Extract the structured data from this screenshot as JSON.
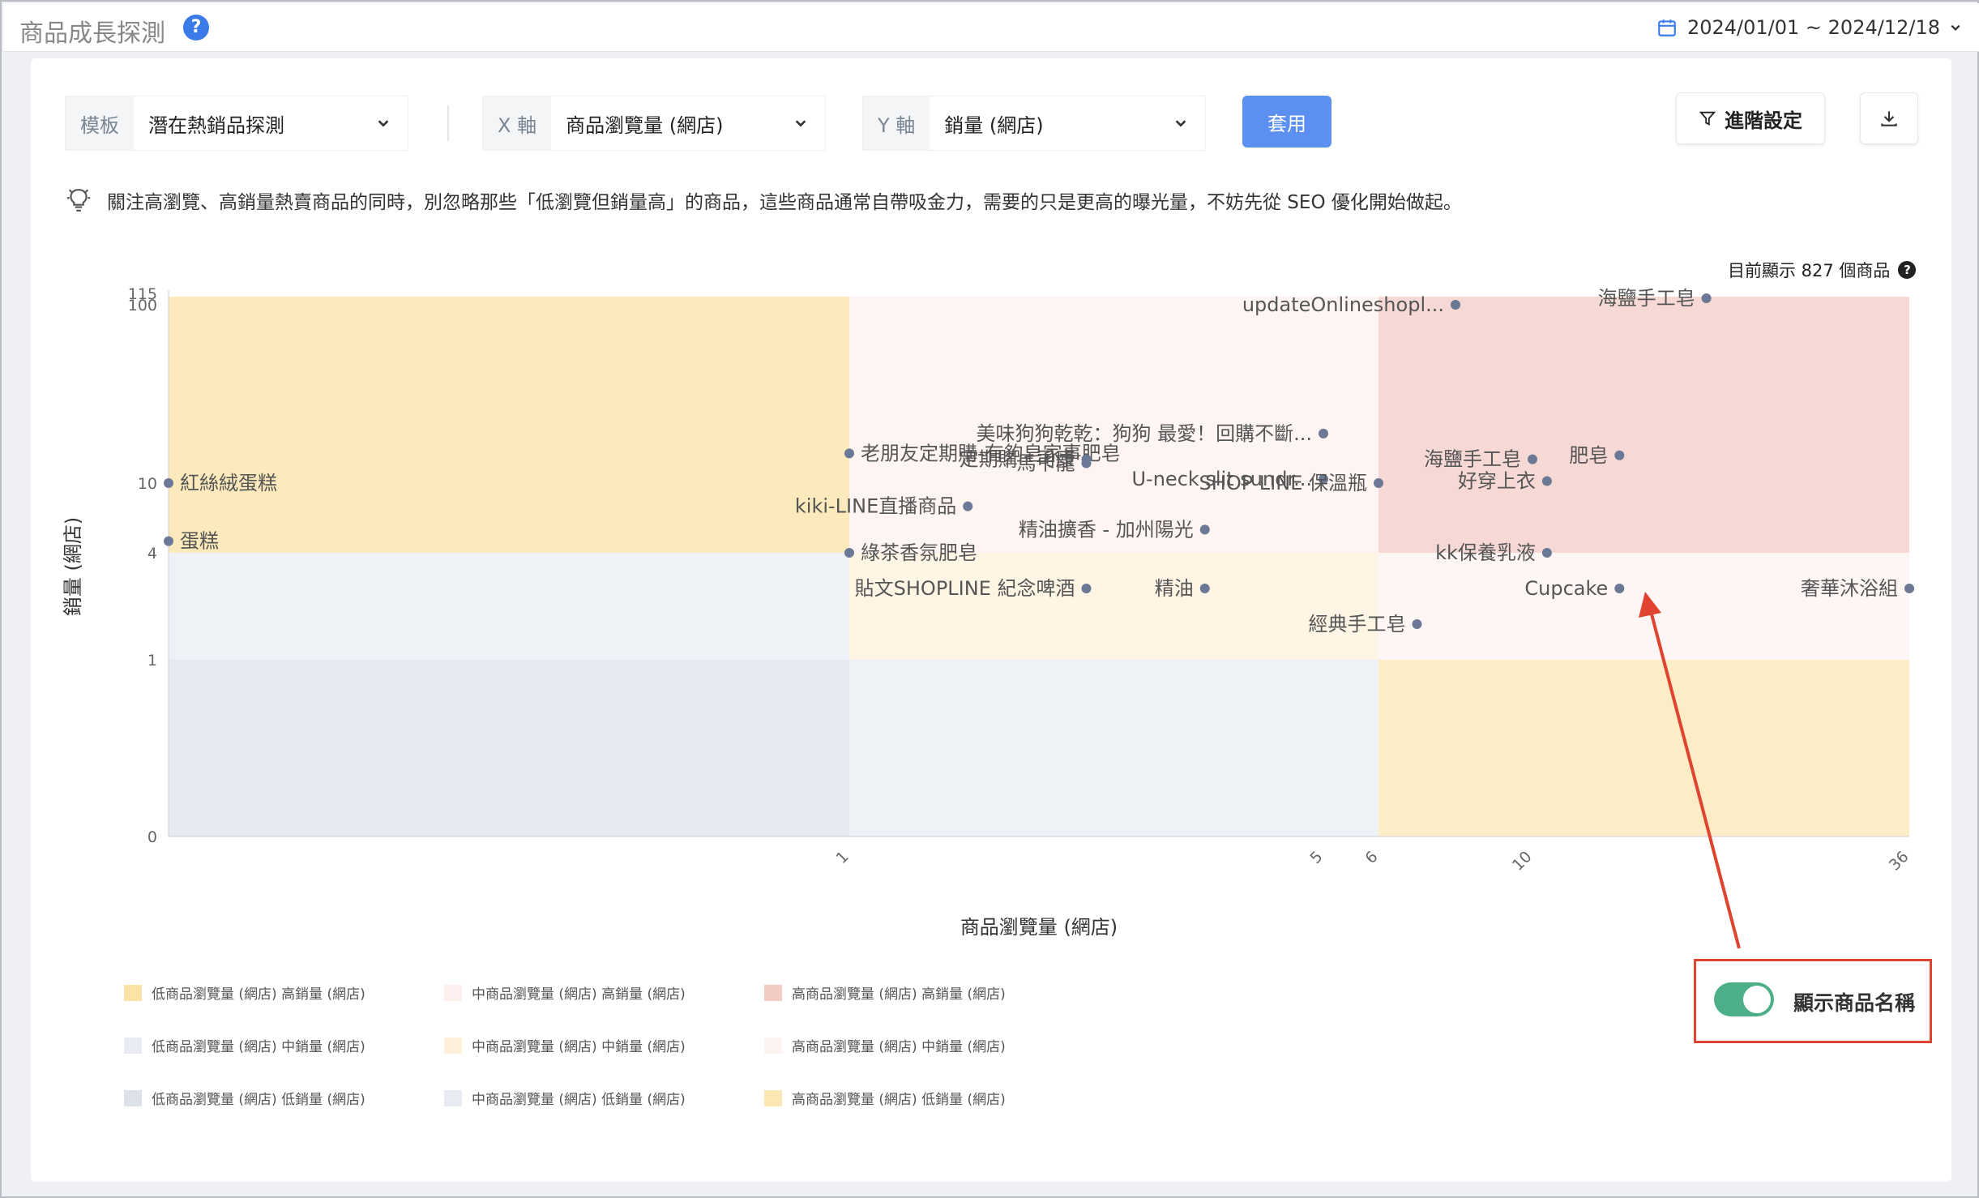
{
  "header": {
    "title": "商品成長探測",
    "date_range": "2024/01/01 ~ 2024/12/18"
  },
  "controls": {
    "template_label": "模板",
    "template_value": "潛在熱銷品探測",
    "x_label": "X 軸",
    "x_value": "商品瀏覽量 (網店)",
    "y_label": "Y 軸",
    "y_value": "銷量 (網店)",
    "apply": "套用",
    "advanced": "進階設定"
  },
  "tip": "關注高瀏覽、高銷量熱賣商品的同時，別忽略那些「低瀏覽但銷量高」的商品，這些商品通常自帶吸金力，需要的只是更高的曝光量，不妨先從 SEO 優化開始做起。",
  "count_text": "目前顯示 827 個商品",
  "toggle_label": "顯示商品名稱",
  "colors": {
    "accent": "#5b8ff2",
    "toggle": "#4caf87",
    "highlight": "#e0432f"
  },
  "chart_data": {
    "type": "scatter",
    "xlabel": "商品瀏覽量 (網店)",
    "ylabel": "銷量 (網店)",
    "x_ticks": [
      "1",
      "5",
      "6",
      "10",
      "36"
    ],
    "y_ticks": [
      "115",
      "100",
      "10",
      "4",
      "1",
      "0"
    ],
    "legend": [
      {
        "name": "低商品瀏覽量 (網店) 高銷量 (網店)",
        "color": "#fbe3a6"
      },
      {
        "name": "中商品瀏覽量 (網店) 高銷量 (網店)",
        "color": "#fdf0ee"
      },
      {
        "name": "高商品瀏覽量 (網店) 高銷量 (網店)",
        "color": "#f3cbc5"
      },
      {
        "name": "低商品瀏覽量 (網店) 中銷量 (網店)",
        "color": "#e8ecf2"
      },
      {
        "name": "中商品瀏覽量 (網店) 中銷量 (網店)",
        "color": "#fdf1dc"
      },
      {
        "name": "高商品瀏覽量 (網店) 中銷量 (網店)",
        "color": "#fdf3f1"
      },
      {
        "name": "低商品瀏覽量 (網店) 低銷量 (網店)",
        "color": "#dde2ea"
      },
      {
        "name": "中商品瀏覽量 (網店) 低銷量 (網店)",
        "color": "#e8ecf2"
      },
      {
        "name": "高商品瀏覽量 (網店) 低銷量 (網店)",
        "color": "#fbe7b4"
      }
    ],
    "points": [
      {
        "label": "updateOnlineshopl...",
        "x": 8,
        "y": 100
      },
      {
        "label": "海鹽手工皂",
        "x": 22,
        "y": 115
      },
      {
        "label": "美味狗狗乾乾：狗狗 最愛！回購不斷...",
        "x": 5,
        "y": 35
      },
      {
        "label": "老朋友定期購-有夠皂家事肥皂",
        "x": 1,
        "y": 25
      },
      {
        "label": "定期購 · 司康",
        "x": 3,
        "y": 22
      },
      {
        "label": "馬卡龍",
        "x": 3,
        "y": 20
      },
      {
        "label": "肥皂",
        "x": 16,
        "y": 24
      },
      {
        "label": "海鹽手工皂",
        "x": 10,
        "y": 22
      },
      {
        "label": "U-neck slit sundr...",
        "x": 5,
        "y": 12
      },
      {
        "label": "SHOP LINE 保溫瓶",
        "x": 6,
        "y": 10
      },
      {
        "label": "好穿上衣",
        "x": 11,
        "y": 11
      },
      {
        "label": "紅絲絨蛋糕",
        "x": 0,
        "y": 10
      },
      {
        "label": "kiki-LINE直播商品",
        "x": 2,
        "y": 8
      },
      {
        "label": "精油擴香 - 加州陽光",
        "x": 4,
        "y": 6
      },
      {
        "label": "綠茶香氛肥皂",
        "x": 1,
        "y": 4
      },
      {
        "label": "蛋糕",
        "x": 0,
        "y": 5
      },
      {
        "label": "kk保養乳液",
        "x": 11,
        "y": 4
      },
      {
        "label": "Cupcake",
        "x": 16,
        "y": 3
      },
      {
        "label": "奢華沐浴組",
        "x": 36,
        "y": 3
      },
      {
        "label": "經典手工皂",
        "x": 7,
        "y": 2
      },
      {
        "label": "精油",
        "x": 4,
        "y": 3
      },
      {
        "label": "貼文SHOPLINE 紀念啤酒",
        "x": 3,
        "y": 3
      }
    ]
  }
}
